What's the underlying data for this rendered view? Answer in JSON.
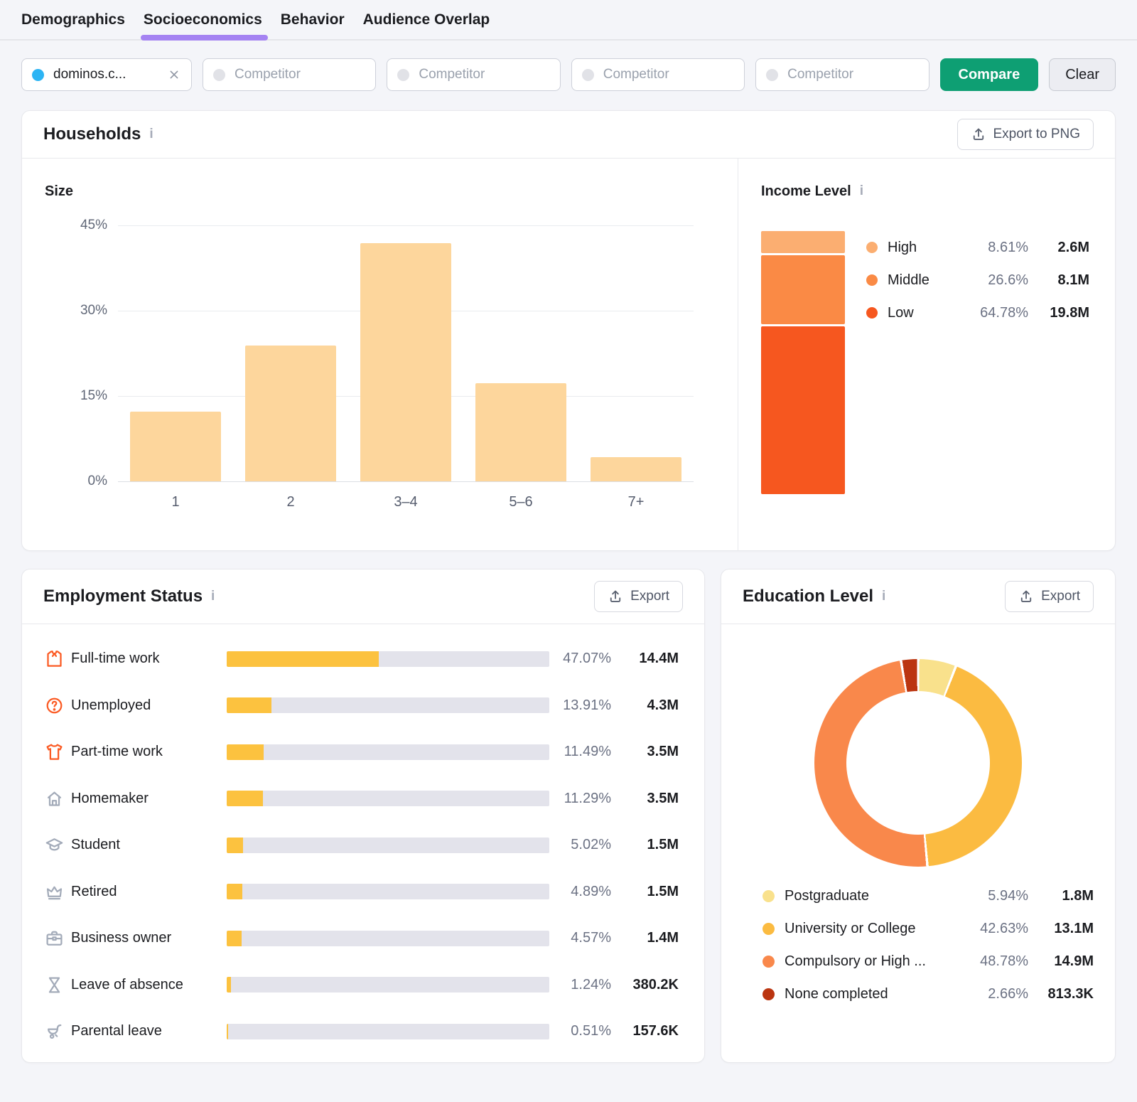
{
  "tabs": [
    {
      "label": "Demographics",
      "active": false
    },
    {
      "label": "Socioeconomics",
      "active": true
    },
    {
      "label": "Behavior",
      "active": false
    },
    {
      "label": "Audience Overlap",
      "active": false
    }
  ],
  "tab_underline_color": "#A583F2",
  "filters": {
    "domain_chip": {
      "label": "dominos.c...",
      "dot_color": "#2CB4F4"
    },
    "competitor_placeholder": "Competitor",
    "competitor_dot_color": "#E1E2E7",
    "competitor_count": 4,
    "compare_label": "Compare",
    "compare_color": "#0E9F73",
    "clear_label": "Clear"
  },
  "households": {
    "title": "Households",
    "export_label": "Export to PNG",
    "size_title": "Size",
    "income_title": "Income Level"
  },
  "employment": {
    "title": "Employment Status",
    "export_label": "Export"
  },
  "education": {
    "title": "Education Level",
    "export_label": "Export"
  },
  "chart_data": [
    {
      "id": "household_size",
      "type": "bar",
      "title": "Size",
      "categories": [
        "1",
        "2",
        "3–4",
        "5–6",
        "7+"
      ],
      "values": [
        12.2,
        23.9,
        41.9,
        17.3,
        4.2
      ],
      "unit": "%",
      "ylim": [
        0,
        45
      ],
      "yticks": [
        {
          "label": "45%",
          "value": 45
        },
        {
          "label": "30%",
          "value": 30
        },
        {
          "label": "15%",
          "value": 15
        },
        {
          "label": "0%",
          "value": 0
        }
      ],
      "bar_color": "#FDD69C",
      "grid": true,
      "legend_position": "none"
    },
    {
      "id": "income_level",
      "type": "stacked-bar",
      "title": "Income Level",
      "segments": [
        {
          "label": "High",
          "percent": 8.61,
          "percent_label": "8.61%",
          "value": "2.6M",
          "color": "#FBAE71"
        },
        {
          "label": "Middle",
          "percent": 26.6,
          "percent_label": "26.6%",
          "value": "8.1M",
          "color": "#FA8A45"
        },
        {
          "label": "Low",
          "percent": 64.78,
          "percent_label": "64.78%",
          "value": "19.8M",
          "color": "#F6571F"
        }
      ],
      "legend_position": "right"
    },
    {
      "id": "employment_status",
      "type": "bar",
      "orientation": "horizontal",
      "title": "Employment Status",
      "xmax": 100,
      "bar_color": "#FCC23F",
      "track_color": "#E3E3EB",
      "rows": [
        {
          "icon": "shirt-icon",
          "icon_color": "#FB5A23",
          "label": "Full-time work",
          "percent": 47.07,
          "percent_label": "47.07%",
          "value": "14.4M"
        },
        {
          "icon": "question-circle-icon",
          "icon_color": "#FB5A23",
          "label": "Unemployed",
          "percent": 13.91,
          "percent_label": "13.91%",
          "value": "4.3M"
        },
        {
          "icon": "tshirt-icon",
          "icon_color": "#FB5A23",
          "label": "Part-time work",
          "percent": 11.49,
          "percent_label": "11.49%",
          "value": "3.5M"
        },
        {
          "icon": "home-icon",
          "icon_color": "#A3ABB9",
          "label": "Homemaker",
          "percent": 11.29,
          "percent_label": "11.29%",
          "value": "3.5M"
        },
        {
          "icon": "graduation-cap-icon",
          "icon_color": "#A3ABB9",
          "label": "Student",
          "percent": 5.02,
          "percent_label": "5.02%",
          "value": "1.5M"
        },
        {
          "icon": "crown-icon",
          "icon_color": "#A3ABB9",
          "label": "Retired",
          "percent": 4.89,
          "percent_label": "4.89%",
          "value": "1.5M"
        },
        {
          "icon": "briefcase-icon",
          "icon_color": "#A3ABB9",
          "label": "Business owner",
          "percent": 4.57,
          "percent_label": "4.57%",
          "value": "1.4M"
        },
        {
          "icon": "hourglass-icon",
          "icon_color": "#A3ABB9",
          "label": "Leave of absence",
          "percent": 1.24,
          "percent_label": "1.24%",
          "value": "380.2K"
        },
        {
          "icon": "stroller-icon",
          "icon_color": "#A3ABB9",
          "label": "Parental leave",
          "percent": 0.51,
          "percent_label": "0.51%",
          "value": "157.6K"
        }
      ]
    },
    {
      "id": "education_level",
      "type": "pie",
      "donut": true,
      "title": "Education Level",
      "start_angle": 0,
      "legend_position": "bottom",
      "slices": [
        {
          "label": "Postgraduate",
          "percent": 5.94,
          "percent_label": "5.94%",
          "value": "1.8M",
          "color": "#F9E18C"
        },
        {
          "label": "University or College",
          "percent": 42.63,
          "percent_label": "42.63%",
          "value": "13.1M",
          "color": "#FBBB41"
        },
        {
          "label": "Compulsory or High ...",
          "percent": 48.78,
          "percent_label": "48.78%",
          "value": "14.9M",
          "color": "#F9884B"
        },
        {
          "label": "None completed",
          "percent": 2.66,
          "percent_label": "2.66%",
          "value": "813.3K",
          "color": "#BB3510"
        }
      ]
    }
  ]
}
